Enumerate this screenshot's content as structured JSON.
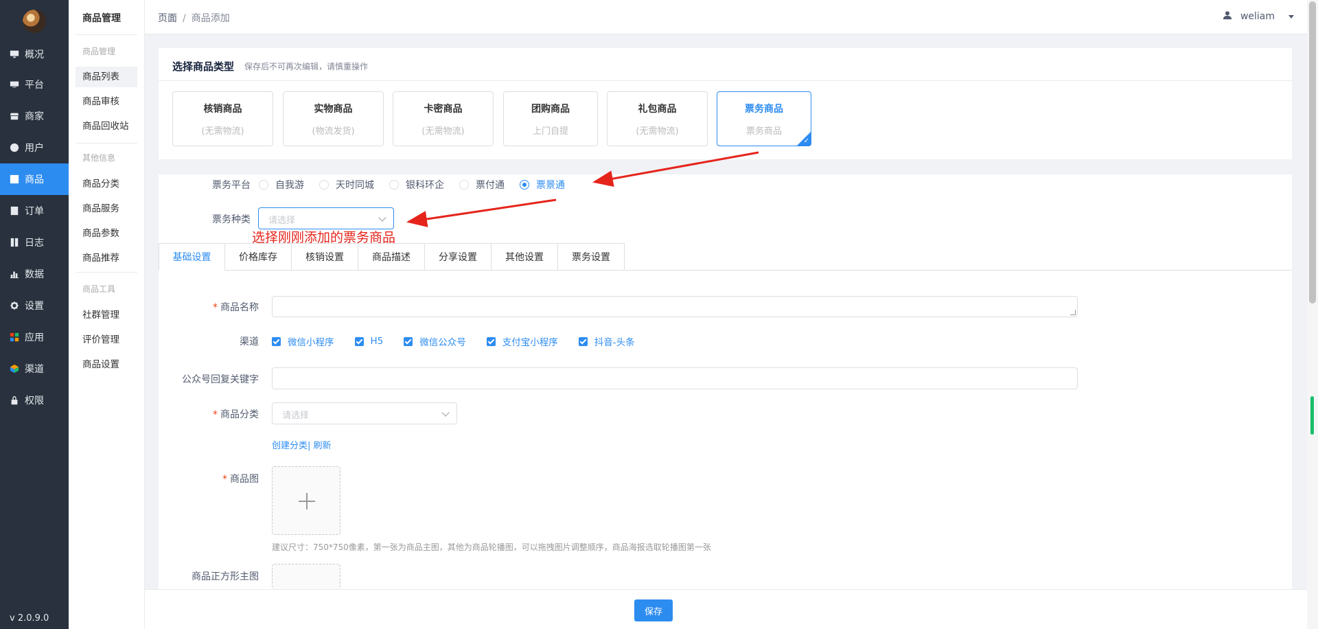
{
  "sidebar": {
    "items": [
      {
        "label": "概况",
        "icon": "monitor-icon"
      },
      {
        "label": "平台",
        "icon": "desktop-icon"
      },
      {
        "label": "商家",
        "icon": "store-icon"
      },
      {
        "label": "用户",
        "icon": "user-icon"
      },
      {
        "label": "商品",
        "icon": "goods-icon"
      },
      {
        "label": "订单",
        "icon": "order-icon"
      },
      {
        "label": "日志",
        "icon": "log-icon"
      },
      {
        "label": "数据",
        "icon": "chart-icon"
      },
      {
        "label": "设置",
        "icon": "gear-icon"
      },
      {
        "label": "应用",
        "icon": "apps-icon"
      },
      {
        "label": "渠道",
        "icon": "cube-icon"
      },
      {
        "label": "权限",
        "icon": "lock-icon"
      }
    ],
    "active_index": 4,
    "version": "v 2.0.9.0"
  },
  "submenu": {
    "title": "商品管理",
    "groups": [
      {
        "label": "商品管理",
        "items": [
          "商品列表",
          "商品审核",
          "商品回收站"
        ]
      },
      {
        "label": "其他信息",
        "items": [
          "商品分类",
          "商品服务",
          "商品参数",
          "商品推荐"
        ]
      },
      {
        "label": "商品工具",
        "items": [
          "社群管理",
          "评价管理",
          "商品设置"
        ]
      }
    ],
    "active": "商品列表"
  },
  "header": {
    "breadcrumb": [
      "页面",
      "商品添加"
    ],
    "breadcrumb_sep": "/",
    "username": "weliam"
  },
  "type_section": {
    "title": "选择商品类型",
    "note": "保存后不可再次编辑，请慎重操作",
    "types": [
      {
        "name": "核销商品",
        "sub": "(无需物流)"
      },
      {
        "name": "实物商品",
        "sub": "(物流发货)"
      },
      {
        "name": "卡密商品",
        "sub": "(无需物流)"
      },
      {
        "name": "团购商品",
        "sub": "上门自提"
      },
      {
        "name": "礼包商品",
        "sub": "(无需物流)"
      },
      {
        "name": "票务商品",
        "sub": "票务商品"
      }
    ],
    "selected_index": 5
  },
  "ticket": {
    "platform_label": "票务平台",
    "platforms": [
      "自我游",
      "天时同城",
      "银科环企",
      "票付通",
      "票景通"
    ],
    "selected_platform": "票景通",
    "kind_label": "票务种类",
    "kind_placeholder": "请选择"
  },
  "annotation": "选择刚刚添加的票务商品",
  "tabs": [
    "基础设置",
    "价格库存",
    "核销设置",
    "商品描述",
    "分享设置",
    "其他设置",
    "票务设置"
  ],
  "form": {
    "name_label": "商品名称",
    "name_value": "",
    "channel_label": "渠道",
    "channels": [
      "微信小程序",
      "H5",
      "微信公众号",
      "支付宝小程序",
      "抖音-头条"
    ],
    "keyword_label": "公众号回复关键字",
    "keyword_value": "",
    "category_label": "商品分类",
    "category_placeholder": "请选择",
    "create_category": "创建分类",
    "link_sep": "|",
    "refresh": "刷新",
    "image_label": "商品图",
    "image_hint": "建议尺寸：750*750像素，第一张为商品主图，其他为商品轮播图，可以拖拽图片调整顺序，商品海报选取轮播图第一张",
    "square_image_label": "商品正方形主图",
    "required_mark": "*"
  },
  "footer": {
    "save_label": "保存"
  },
  "colors": {
    "primary": "#2d8cf0",
    "sidebar_bg": "#28313d",
    "annotation": "#e5241b"
  }
}
